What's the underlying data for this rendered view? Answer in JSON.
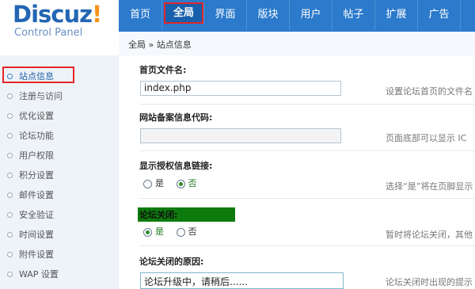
{
  "brand": {
    "logo_main": "Discuz",
    "logo_bang": "!",
    "subtitle": "Control Panel"
  },
  "nav": {
    "items": [
      {
        "label": "首页"
      },
      {
        "label": "全局"
      },
      {
        "label": "界面"
      },
      {
        "label": "版块"
      },
      {
        "label": "用户"
      },
      {
        "label": "帖子"
      },
      {
        "label": "扩展"
      },
      {
        "label": "广告"
      }
    ],
    "active_index": 1
  },
  "breadcrumb": "全局 » 站点信息",
  "sidebar": {
    "items": [
      {
        "label": "站点信息"
      },
      {
        "label": "注册与访问"
      },
      {
        "label": "优化设置"
      },
      {
        "label": "论坛功能"
      },
      {
        "label": "用户权限"
      },
      {
        "label": "积分设置"
      },
      {
        "label": "邮件设置"
      },
      {
        "label": "安全验证"
      },
      {
        "label": "时间设置"
      },
      {
        "label": "附件设置"
      },
      {
        "label": "WAP 设置"
      }
    ],
    "active_index": 0
  },
  "form": {
    "index_file": {
      "label": "首页文件名:",
      "value": "index.php",
      "hint": "设置论坛首页的文件名"
    },
    "icp": {
      "label": "网站备案信息代码:",
      "value": "",
      "hint": "页面底部可以显示 IC"
    },
    "license_link": {
      "label": "显示授权信息链接:",
      "opt_yes": "是",
      "opt_no": "否",
      "selected": "否",
      "hint": "选择“是”将在页脚显示"
    },
    "closed": {
      "label": "论坛关闭:",
      "opt_yes": "是",
      "opt_no": "否",
      "selected": "是",
      "hint": "暂时将论坛关闭，其他"
    },
    "closed_reason": {
      "label": "论坛关闭的原因:",
      "value": "论坛升级中，请稍后......",
      "hint": "论坛关闭时出现的提示"
    }
  },
  "colors": {
    "header_blue": "#2b7acb",
    "logo_orange": "#f7931d",
    "highlight_red": "#e3262a",
    "green_badge": "#0c7a0c"
  }
}
